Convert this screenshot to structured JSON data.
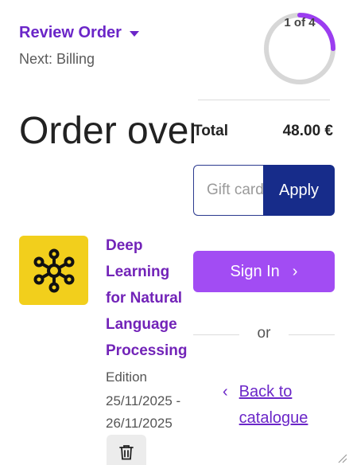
{
  "header": {
    "review_toggle_label": "Review Order",
    "next_step": "Next: Billing"
  },
  "progress": {
    "label": "1 of 4",
    "current": 1,
    "total": 4,
    "color": "#9b3df0",
    "track_color": "#d7d7d7"
  },
  "main": {
    "title": "Order overview"
  },
  "order_item": {
    "icon": "network-nodes-icon",
    "tile_color": "#f2cf1c",
    "name": "Deep\nLearning\nfor Natural\nLanguage\nProcessing",
    "edition_label": "Edition",
    "edition_dates": "25/11/2025 -\n26/11/2025",
    "remove_icon": "trash-icon"
  },
  "summary": {
    "total_label": "Total",
    "total_value": "48.00 €"
  },
  "gift": {
    "placeholder": "Gift card",
    "apply_label": "Apply"
  },
  "actions": {
    "sign_in_label": "Sign In",
    "sign_in_chevron": "›",
    "or_text": "or",
    "back_chevron": "‹",
    "back_label": "Back to\ncatalogue"
  },
  "colors": {
    "accent_purple": "#6b26c8",
    "sign_in_bg": "#a24cf3",
    "apply_bg": "#172c8a"
  }
}
